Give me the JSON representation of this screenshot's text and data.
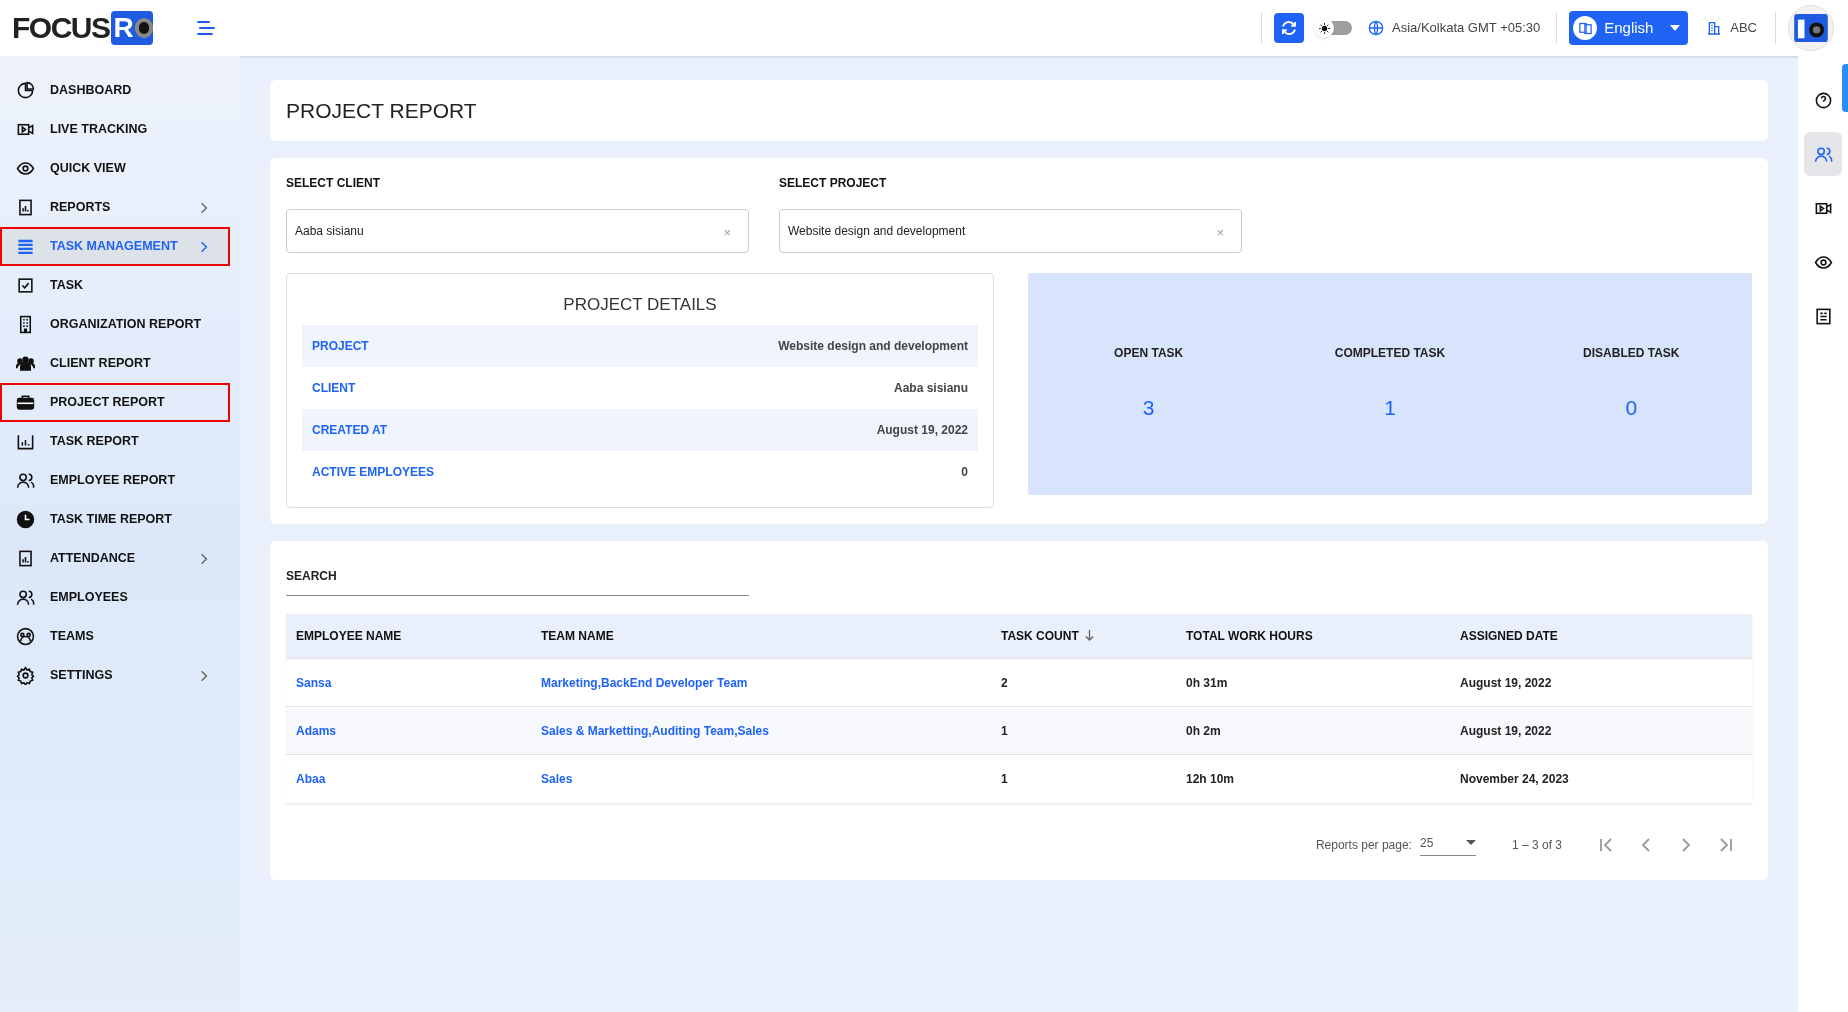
{
  "header": {
    "logo_text": "FOCUS",
    "logo_mark": "R",
    "timezone": "Asia/Kolkata GMT +05:30",
    "dark_mode": false,
    "language": "English",
    "company": "ABC"
  },
  "sidebar": {
    "items": [
      {
        "label": "DASHBOARD",
        "selected": false,
        "outlined": false,
        "has_submenu": false
      },
      {
        "label": "LIVE TRACKING",
        "selected": false,
        "outlined": false,
        "has_submenu": false
      },
      {
        "label": "QUICK VIEW",
        "selected": false,
        "outlined": false,
        "has_submenu": false
      },
      {
        "label": "REPORTS",
        "selected": false,
        "outlined": false,
        "has_submenu": true
      },
      {
        "label": "TASK MANAGEMENT",
        "selected": true,
        "outlined": true,
        "has_submenu": true
      },
      {
        "label": "TASK",
        "selected": false,
        "outlined": false,
        "has_submenu": false
      },
      {
        "label": "ORGANIZATION REPORT",
        "selected": false,
        "outlined": false,
        "has_submenu": false
      },
      {
        "label": "CLIENT REPORT",
        "selected": false,
        "outlined": false,
        "has_submenu": false
      },
      {
        "label": "PROJECT REPORT",
        "selected": false,
        "outlined": true,
        "has_submenu": false
      },
      {
        "label": "TASK REPORT",
        "selected": false,
        "outlined": false,
        "has_submenu": false
      },
      {
        "label": "EMPLOYEE REPORT",
        "selected": false,
        "outlined": false,
        "has_submenu": false
      },
      {
        "label": "TASK TIME REPORT",
        "selected": false,
        "outlined": false,
        "has_submenu": false
      },
      {
        "label": "ATTENDANCE",
        "selected": false,
        "outlined": false,
        "has_submenu": true
      },
      {
        "label": "EMPLOYEES",
        "selected": false,
        "outlined": false,
        "has_submenu": false
      },
      {
        "label": "TEAMS",
        "selected": false,
        "outlined": false,
        "has_submenu": false
      },
      {
        "label": "SETTINGS",
        "selected": false,
        "outlined": false,
        "has_submenu": true
      }
    ]
  },
  "page_title": "PROJECT REPORT",
  "filters": [
    {
      "label": "SELECT CLIENT",
      "value": "Aaba sisianu",
      "clear": "×"
    },
    {
      "label": "SELECT PROJECT",
      "value": "Website design and development",
      "clear": "×"
    }
  ],
  "project_details": {
    "title": "PROJECT DETAILS",
    "rows": [
      {
        "label": "PROJECT",
        "value": "Website design and development"
      },
      {
        "label": "CLIENT",
        "value": "Aaba sisianu"
      },
      {
        "label": "CREATED AT",
        "value": "August 19, 2022"
      },
      {
        "label": "ACTIVE EMPLOYEES",
        "value": "0"
      }
    ]
  },
  "stats": [
    {
      "label": "OPEN TASK",
      "value": "3"
    },
    {
      "label": "COMPLETED TASK",
      "value": "1"
    },
    {
      "label": "DISABLED TASK",
      "value": "0"
    }
  ],
  "search": {
    "label": "SEARCH"
  },
  "table": {
    "columns": [
      {
        "label": "EMPLOYEE NAME",
        "sorted": false
      },
      {
        "label": "TEAM NAME",
        "sorted": false
      },
      {
        "label": "TASK COUNT",
        "sorted": true
      },
      {
        "label": "TOTAL WORK HOURS",
        "sorted": false
      },
      {
        "label": "ASSIGNED DATE",
        "sorted": false
      }
    ],
    "rows": [
      [
        "Sansa",
        "Marketing,BackEnd Developer Team",
        "2",
        "0h 31m",
        "August 19, 2022"
      ],
      [
        "Adams",
        "Sales & Marketting,Auditing Team,Sales",
        "1",
        "0h 2m",
        "August 19, 2022"
      ],
      [
        "Abaa",
        "Sales",
        "1",
        "12h 10m",
        "November 24, 2023"
      ]
    ]
  },
  "pagination": {
    "per_page_label": "Reports per page:",
    "per_page": "25",
    "range": "1 – 3 of 3"
  },
  "right_rail": [
    {
      "selected": false
    },
    {
      "selected": true
    },
    {
      "selected": false
    },
    {
      "selected": false
    },
    {
      "selected": false
    }
  ]
}
